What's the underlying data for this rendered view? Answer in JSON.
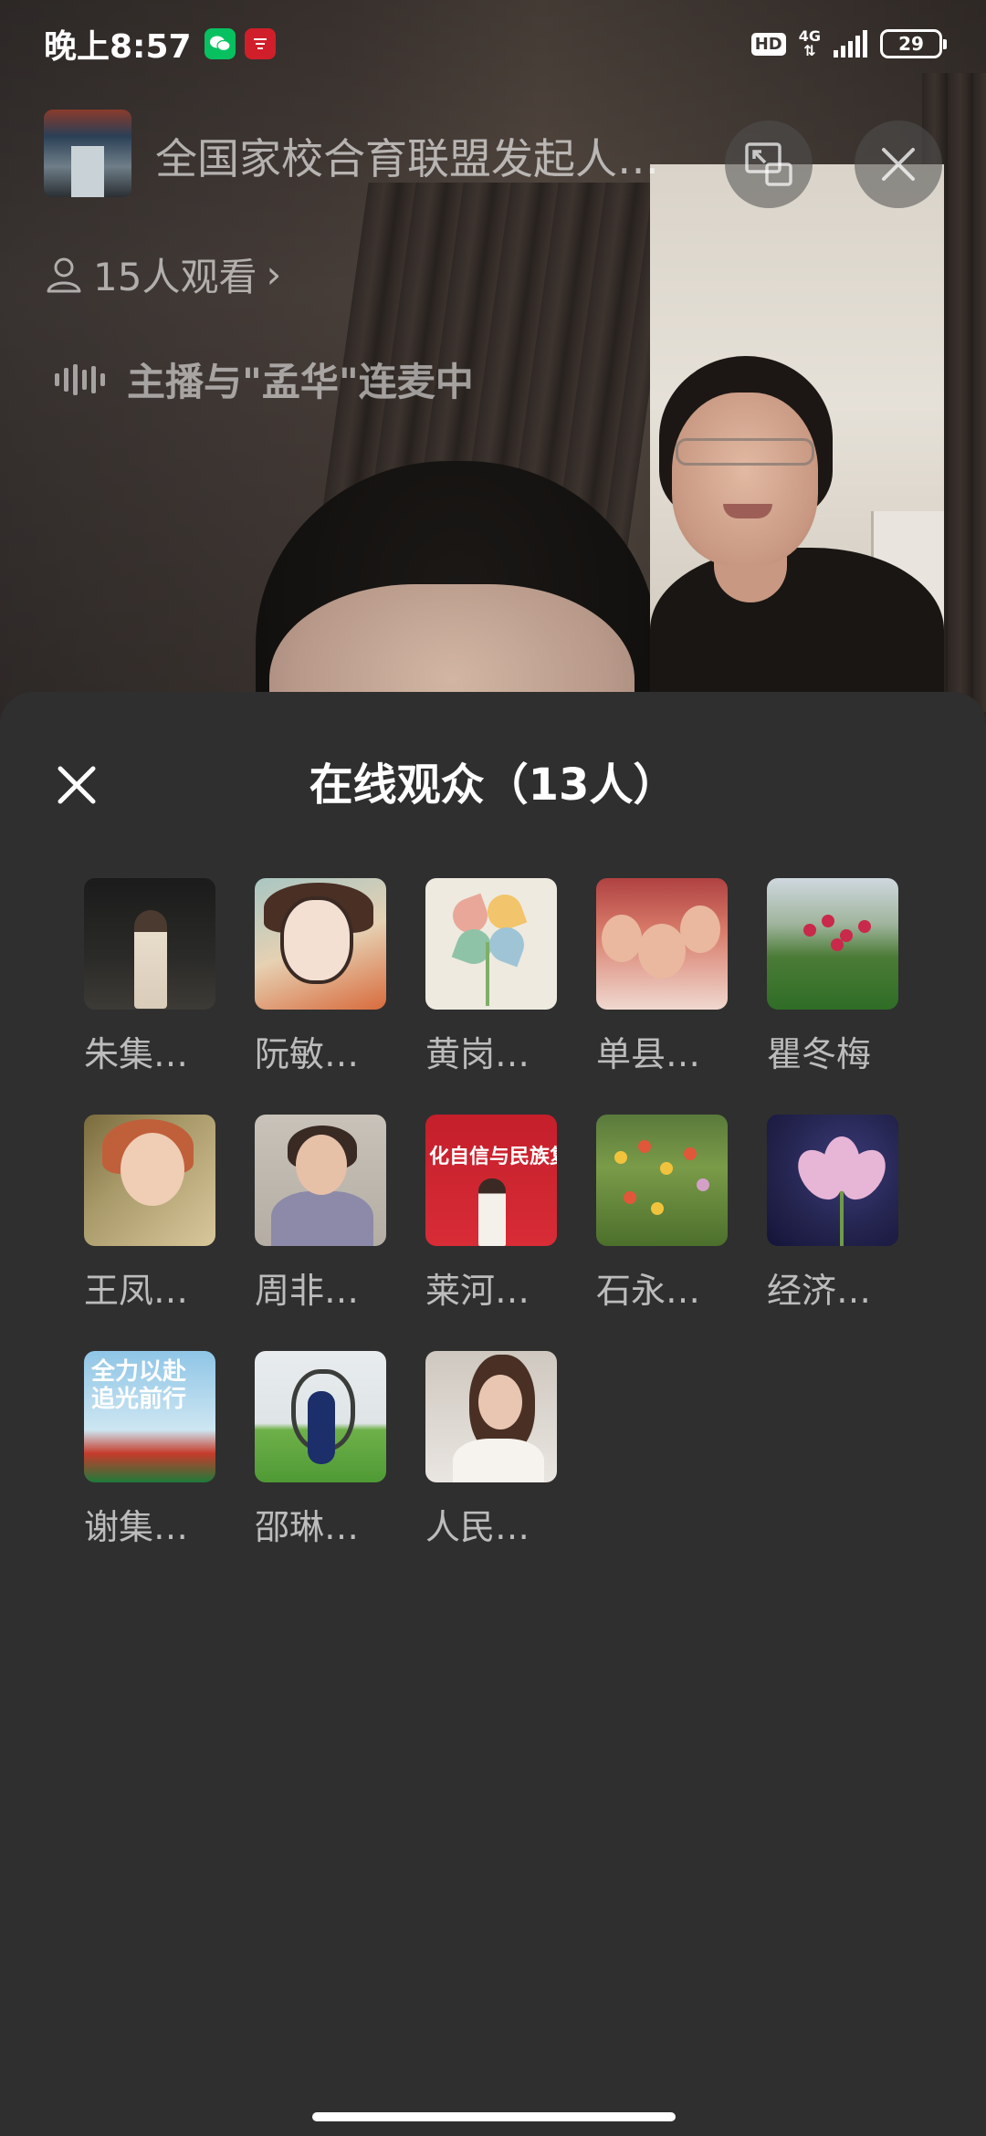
{
  "status_bar": {
    "time": "晚上8:57",
    "hd": "HD",
    "network": "4G",
    "network_arrows": "⇅",
    "battery": "29"
  },
  "live_header": {
    "title": "全国家校合育联盟发起人…",
    "viewers": "15人观看",
    "viewers_chevron": "›",
    "mic_status": "主播与\"孟华\"连麦中"
  },
  "audience_sheet": {
    "title": "在线观众（13人）",
    "members": [
      {
        "name": "朱集…"
      },
      {
        "name": "阮敏…"
      },
      {
        "name": "黄岗…"
      },
      {
        "name": "单县…"
      },
      {
        "name": "瞿冬梅"
      },
      {
        "name": "王凤…"
      },
      {
        "name": "周非…"
      },
      {
        "name": "莱河…"
      },
      {
        "name": "石永…"
      },
      {
        "name": "经济…"
      },
      {
        "name": "谢集…"
      },
      {
        "name": "邵琳…"
      },
      {
        "name": "人民…"
      }
    ],
    "avatar_texts": {
      "banner": "化自信与民族复",
      "poster_line1": "全力以赴",
      "poster_line2": "追光前行"
    }
  },
  "colors": {
    "sheet_bg": "#2f2f2f",
    "wechat_green": "#07c160"
  }
}
